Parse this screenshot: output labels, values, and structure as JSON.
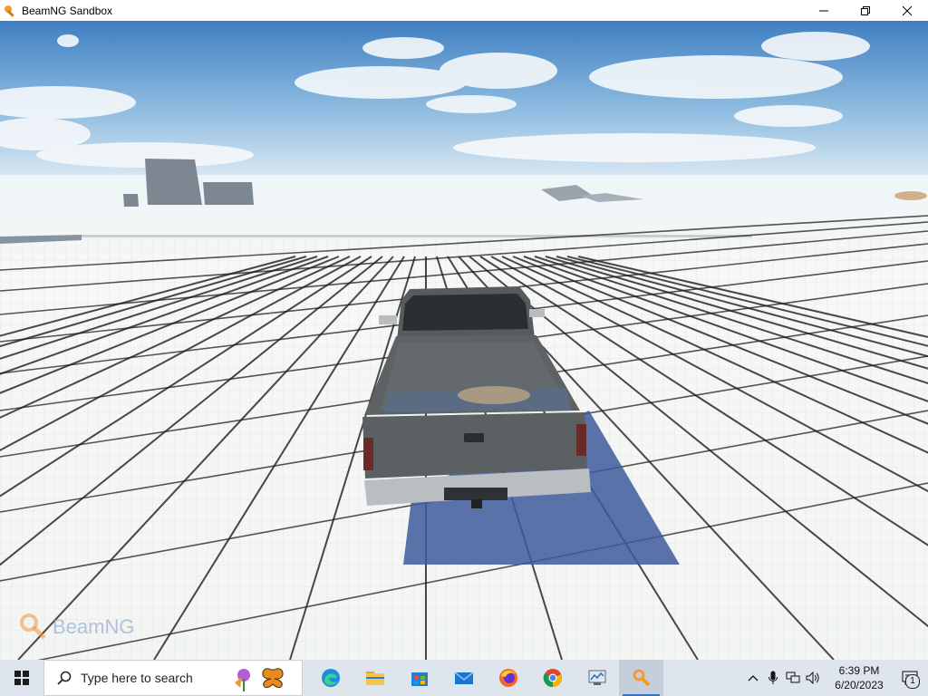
{
  "window": {
    "title": "BeamNG Sandbox",
    "controls": [
      "minimize",
      "maximize",
      "close"
    ]
  },
  "viewport": {
    "scene": "pickup-truck-on-grid-map",
    "watermark": "BeamNG"
  },
  "taskbar": {
    "search_placeholder": "Type here to search",
    "pinned_apps": [
      "edge",
      "file-explorer",
      "microsoft-store",
      "mail",
      "firefox",
      "chrome",
      "control-panel",
      "beamng"
    ],
    "active_app": "beamng",
    "clock_time": "6:39 PM",
    "clock_date": "6/20/2023",
    "notification_count": "1"
  }
}
